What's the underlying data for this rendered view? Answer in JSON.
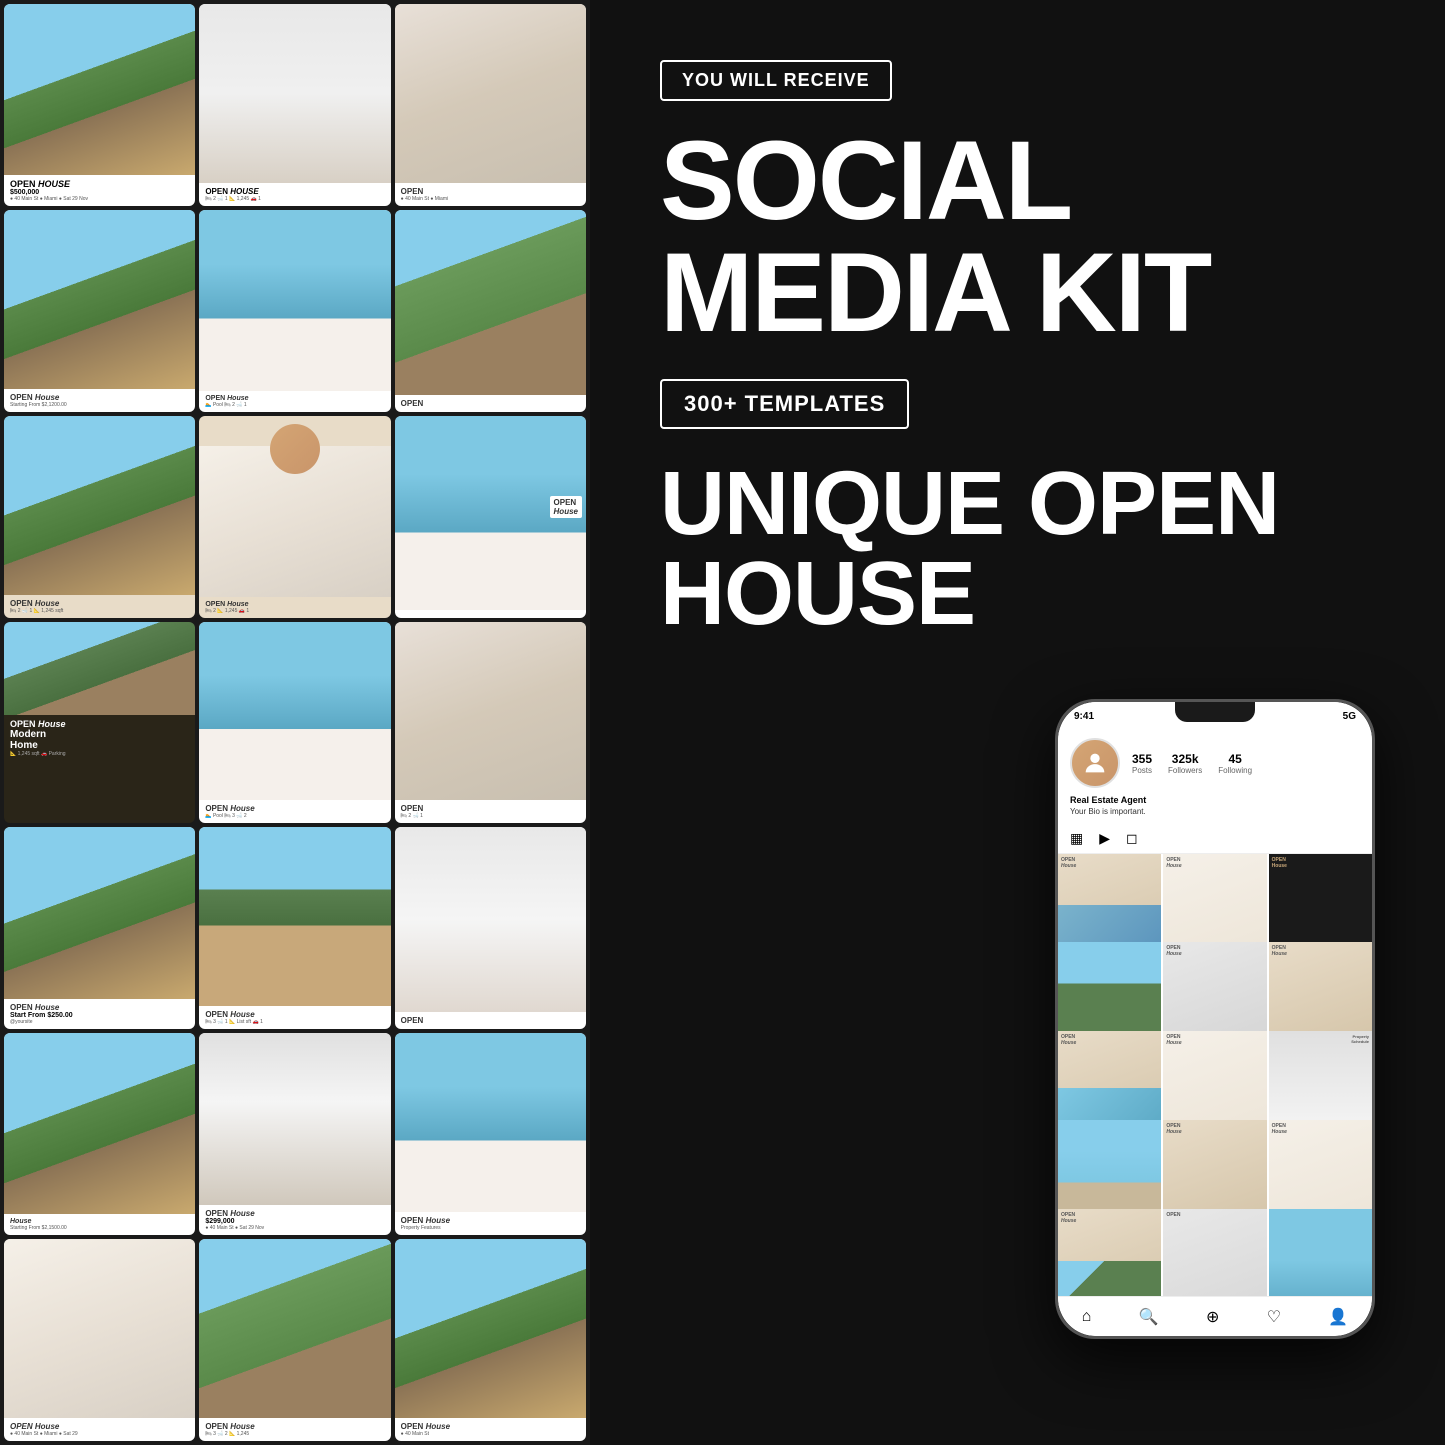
{
  "right": {
    "badge_you_will_receive": "YOU WILL RECEIVE",
    "main_title_line1": "SOCIAL",
    "main_title_line2": "MEDIA KIT",
    "templates_badge": "300+ TEMPLATES",
    "sub_title_line1": "UNIQUE OPEN",
    "sub_title_line2": "HOUSE"
  },
  "phone": {
    "status_time": "9:41",
    "status_signal": "5G",
    "stats": [
      {
        "num": "355",
        "label": "Posts"
      },
      {
        "num": "325k",
        "label": "Followers"
      },
      {
        "num": "45",
        "label": "Following"
      }
    ],
    "username": "Real Estate Agent",
    "bio": "Your Bio is important.",
    "grid_cells": [
      "open-beige",
      "open-white",
      "open-dark",
      "open-white",
      "open-beige",
      "open-pool",
      "open-beige",
      "open-white",
      "open-modern",
      "open-dark",
      "open-white",
      "open-beige",
      "open-pool",
      "open-beige",
      "open-white",
      "open-white",
      "open-dark",
      "open-beige"
    ]
  },
  "cards": [
    {
      "type": "white",
      "photo": "villa",
      "title": "OPEN House",
      "price": "$500,000"
    },
    {
      "type": "white",
      "photo": "modern",
      "title": "OPEN House",
      "price": ""
    },
    {
      "type": "white",
      "photo": "luxury",
      "title": "OPEN",
      "price": ""
    },
    {
      "type": "white",
      "photo": "interior",
      "title": "OPEN House",
      "price": "$2,1200.00"
    },
    {
      "type": "white",
      "photo": "pool",
      "title": "OPEN House",
      "price": ""
    },
    {
      "type": "white",
      "photo": "outdoor",
      "title": "OPEN",
      "price": ""
    },
    {
      "type": "beige",
      "photo": "villa",
      "title": "OPEN House",
      "price": ""
    },
    {
      "type": "beige",
      "photo": "interior",
      "title": "OPEN House",
      "price": ""
    },
    {
      "type": "white",
      "photo": "pool",
      "title": "OPEN",
      "price": ""
    },
    {
      "type": "dark",
      "photo": "modern",
      "title": "OPEN House Modern Home",
      "price": ""
    },
    {
      "type": "white",
      "photo": "pool",
      "title": "OPEN House",
      "price": ""
    },
    {
      "type": "white",
      "photo": "luxury",
      "title": "OPEN House",
      "price": ""
    },
    {
      "type": "white",
      "photo": "villa",
      "title": "OPEN House",
      "price": "$250.00"
    },
    {
      "type": "white",
      "photo": "palm",
      "title": "OPEN House",
      "price": ""
    },
    {
      "type": "white",
      "photo": "bathroom",
      "title": "OPEN",
      "price": ""
    },
    {
      "type": "white",
      "photo": "villa",
      "title": "House",
      "price": ""
    },
    {
      "type": "white",
      "photo": "modern",
      "title": "OPEN House",
      "price": "$299,000"
    },
    {
      "type": "white",
      "photo": "pool",
      "title": "OPEN House",
      "price": ""
    },
    {
      "type": "white",
      "photo": "interior",
      "title": "OPEN House",
      "price": ""
    },
    {
      "type": "white",
      "photo": "villa",
      "title": "OPEN House",
      "price": ""
    },
    {
      "type": "white",
      "photo": "outdoor",
      "title": "OPEN House",
      "price": ""
    }
  ]
}
